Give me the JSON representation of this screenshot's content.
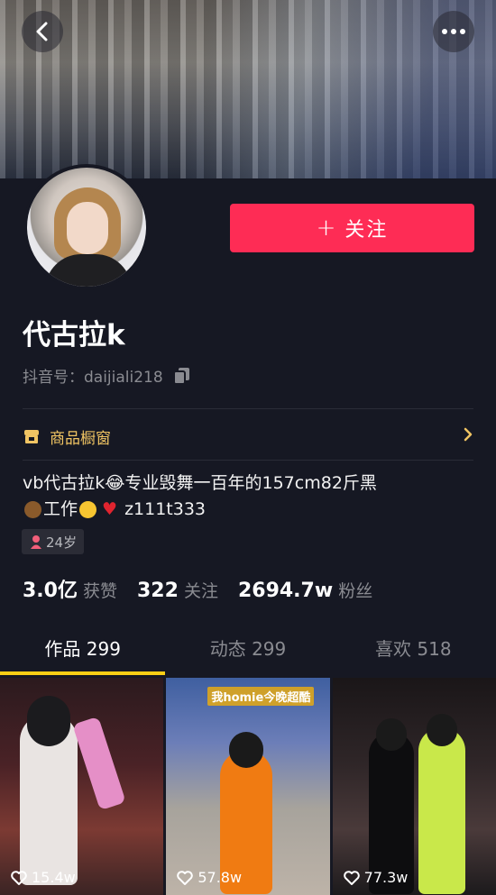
{
  "profile": {
    "name": "代古拉k",
    "douyin_id": "抖音号：daijiali218",
    "follow_label": "关注",
    "shop_label": "商品橱窗",
    "bio_line1": "vb代古拉k😂专业毁舞一百年的157cm82斤黑",
    "bio_line2_text": "工作",
    "bio_line2_id": "z111t333",
    "age": "24岁"
  },
  "stats": [
    {
      "num": "3.0亿",
      "label": "获赞"
    },
    {
      "num": "322",
      "label": "关注"
    },
    {
      "num": "2694.7w",
      "label": "粉丝"
    }
  ],
  "tabs": [
    {
      "label": "作品 299",
      "active": true
    },
    {
      "label": "动态 299",
      "active": false
    },
    {
      "label": "喜欢 518",
      "active": false
    }
  ],
  "videos": [
    {
      "likes": "15.4w"
    },
    {
      "likes": "57.8w",
      "caption": "我homie今晚超酷"
    },
    {
      "likes": "77.3w"
    }
  ],
  "colors": {
    "accent": "#fe2c55",
    "background": "#161823",
    "tab_indicator": "#face15",
    "shop": "#f0c463"
  },
  "icons": [
    "back-arrow-icon",
    "more-icon",
    "copy-icon",
    "shop-icon",
    "chevron-right-icon",
    "gender-female-icon",
    "heart-icon"
  ]
}
